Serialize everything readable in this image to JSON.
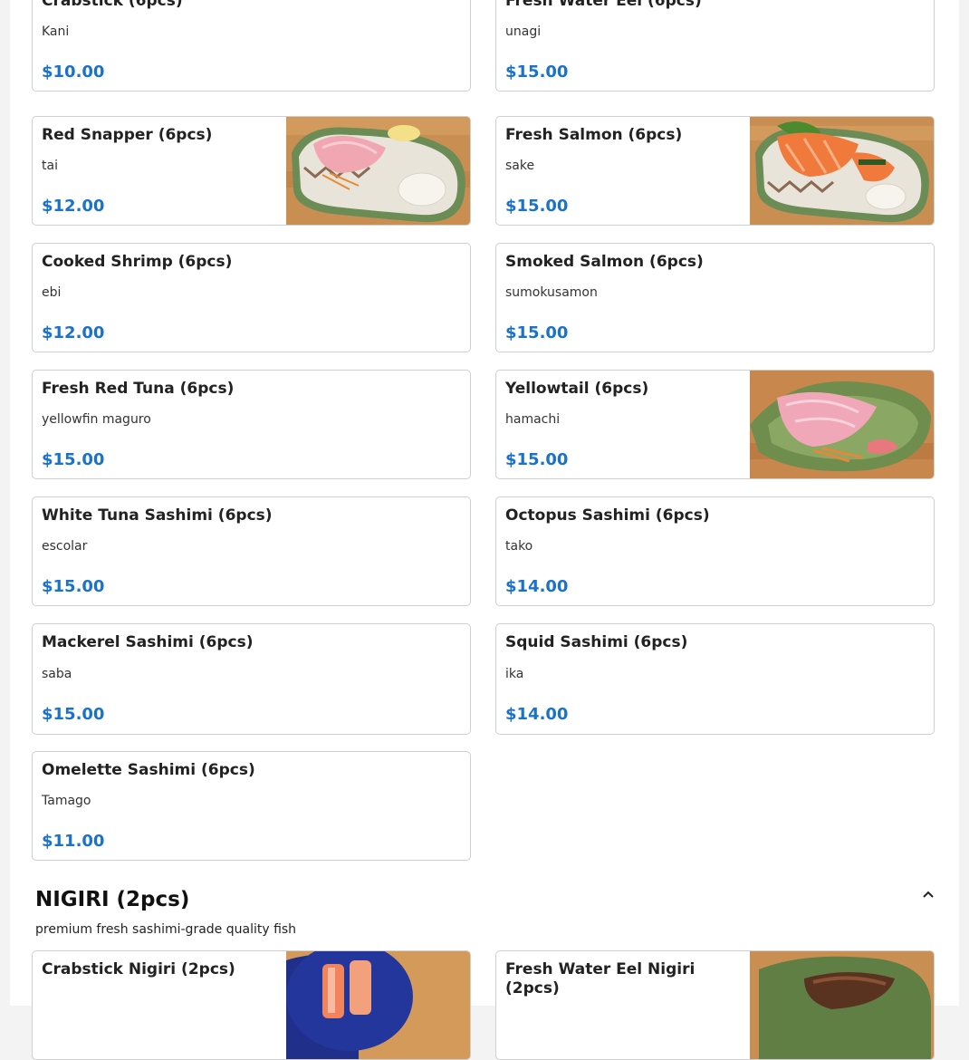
{
  "sashimi": {
    "items": [
      {
        "name": "Crabstick (6pcs)",
        "desc": "Kani",
        "price": "$10.00"
      },
      {
        "name": "Fresh Water Eel (6pcs)",
        "desc": "unagi",
        "price": "$15.00"
      },
      {
        "name": "Red Snapper (6pcs)",
        "desc": "tai",
        "price": "$12.00"
      },
      {
        "name": "Fresh Salmon (6pcs)",
        "desc": "sake",
        "price": "$15.00"
      },
      {
        "name": "Cooked Shrimp (6pcs)",
        "desc": "ebi",
        "price": "$12.00"
      },
      {
        "name": "Smoked Salmon (6pcs)",
        "desc": "sumokusamon",
        "price": "$15.00"
      },
      {
        "name": "Fresh Red Tuna (6pcs)",
        "desc": "yellowfin maguro",
        "price": "$15.00"
      },
      {
        "name": "Yellowtail (6pcs)",
        "desc": "hamachi",
        "price": "$15.00"
      },
      {
        "name": "White Tuna Sashimi (6pcs)",
        "desc": "escolar",
        "price": "$15.00"
      },
      {
        "name": "Octopus Sashimi (6pcs)",
        "desc": "tako",
        "price": "$14.00"
      },
      {
        "name": "Mackerel Sashimi (6pcs)",
        "desc": "saba",
        "price": "$15.00"
      },
      {
        "name": "Squid Sashimi (6pcs)",
        "desc": "ika",
        "price": "$14.00"
      },
      {
        "name": "Omelette Sashimi (6pcs)",
        "desc": "Tamago",
        "price": "$11.00"
      }
    ]
  },
  "nigiri": {
    "title": "NIGIRI (2pcs)",
    "subtitle": "premium fresh sashimi-grade quality fish",
    "collapse_icon": "chevron-up-icon",
    "items": [
      {
        "name": "Crabstick Nigiri (2pcs)"
      },
      {
        "name": "Fresh Water Eel Nigiri (2pcs)"
      }
    ]
  },
  "colors": {
    "price": "#1a73c8",
    "border": "#cfcfcf"
  }
}
